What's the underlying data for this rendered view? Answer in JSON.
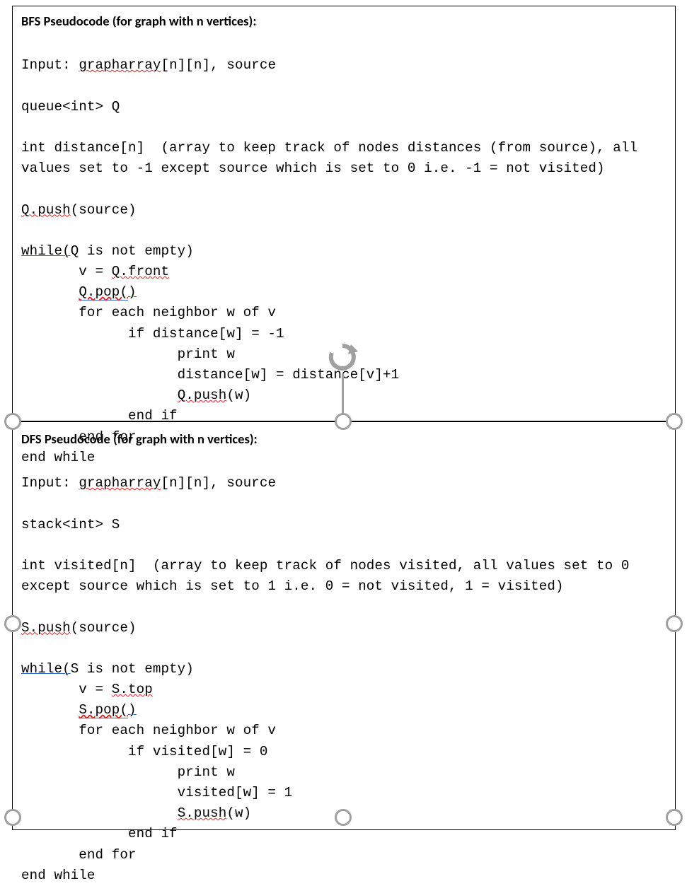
{
  "bfs": {
    "title": "BFS Pseudocode (for graph with n vertices):",
    "input_prefix": "Input: ",
    "input_arr": "grapharray",
    "input_suffix": "[n][n], source",
    "queue_decl": "queue<int> Q",
    "distance_decl": "int distance[n]  (array to keep track of nodes distances (from source), all\nvalues set to -1 except source which is set to 0 i.e. -1 = not visited)",
    "push_prefix": "Q.push",
    "push_suffix": "(source)",
    "while_kw": "while(",
    "while_cond": "Q is not empty)",
    "v_assign_prefix": "       v = ",
    "v_assign_val": "Q.front",
    "pop_indent": "       ",
    "pop_call": "Q.pop(",
    "pop_close": ")",
    "for_line": "       for each neighbor w of v",
    "if_line": "             if distance[w] = -1",
    "print_line": "                   print w",
    "dist_update": "                   distance[w] = distance[v]+1",
    "qpush_indent": "                   ",
    "qpush_call": "Q.push",
    "qpush_arg": "(w)",
    "endif": "             end if",
    "endfor": "       end for",
    "endwhile": "end while"
  },
  "dfs": {
    "title": "DFS Pseudocode (for graph with n vertices):",
    "input_prefix": "Input: ",
    "input_arr": "grapharray",
    "input_suffix": "[n][n], source",
    "stack_decl": "stack<int> S",
    "visited_decl": "int visited[n]  (array to keep track of nodes visited, all values set to 0\nexcept source which is set to 1 i.e. 0 = not visited, 1 = visited)",
    "push_prefix": "S.push",
    "push_suffix": "(source)",
    "while_kw": "while(",
    "while_cond": "S is not empty)",
    "v_assign_prefix": "       v = ",
    "v_assign_val": "S.top",
    "pop_indent": "       ",
    "pop_call": "S.pop(",
    "pop_close": ")",
    "for_line": "       for each neighbor w of v",
    "if_line": "             if visited[w] = 0",
    "print_line": "                   print w",
    "vis_update": "                   visited[w] = 1",
    "spush_indent": "                   ",
    "spush_call": "S.push",
    "spush_arg": "(w)",
    "endif": "             end if",
    "endfor": "       end for",
    "endwhile": "end while"
  }
}
